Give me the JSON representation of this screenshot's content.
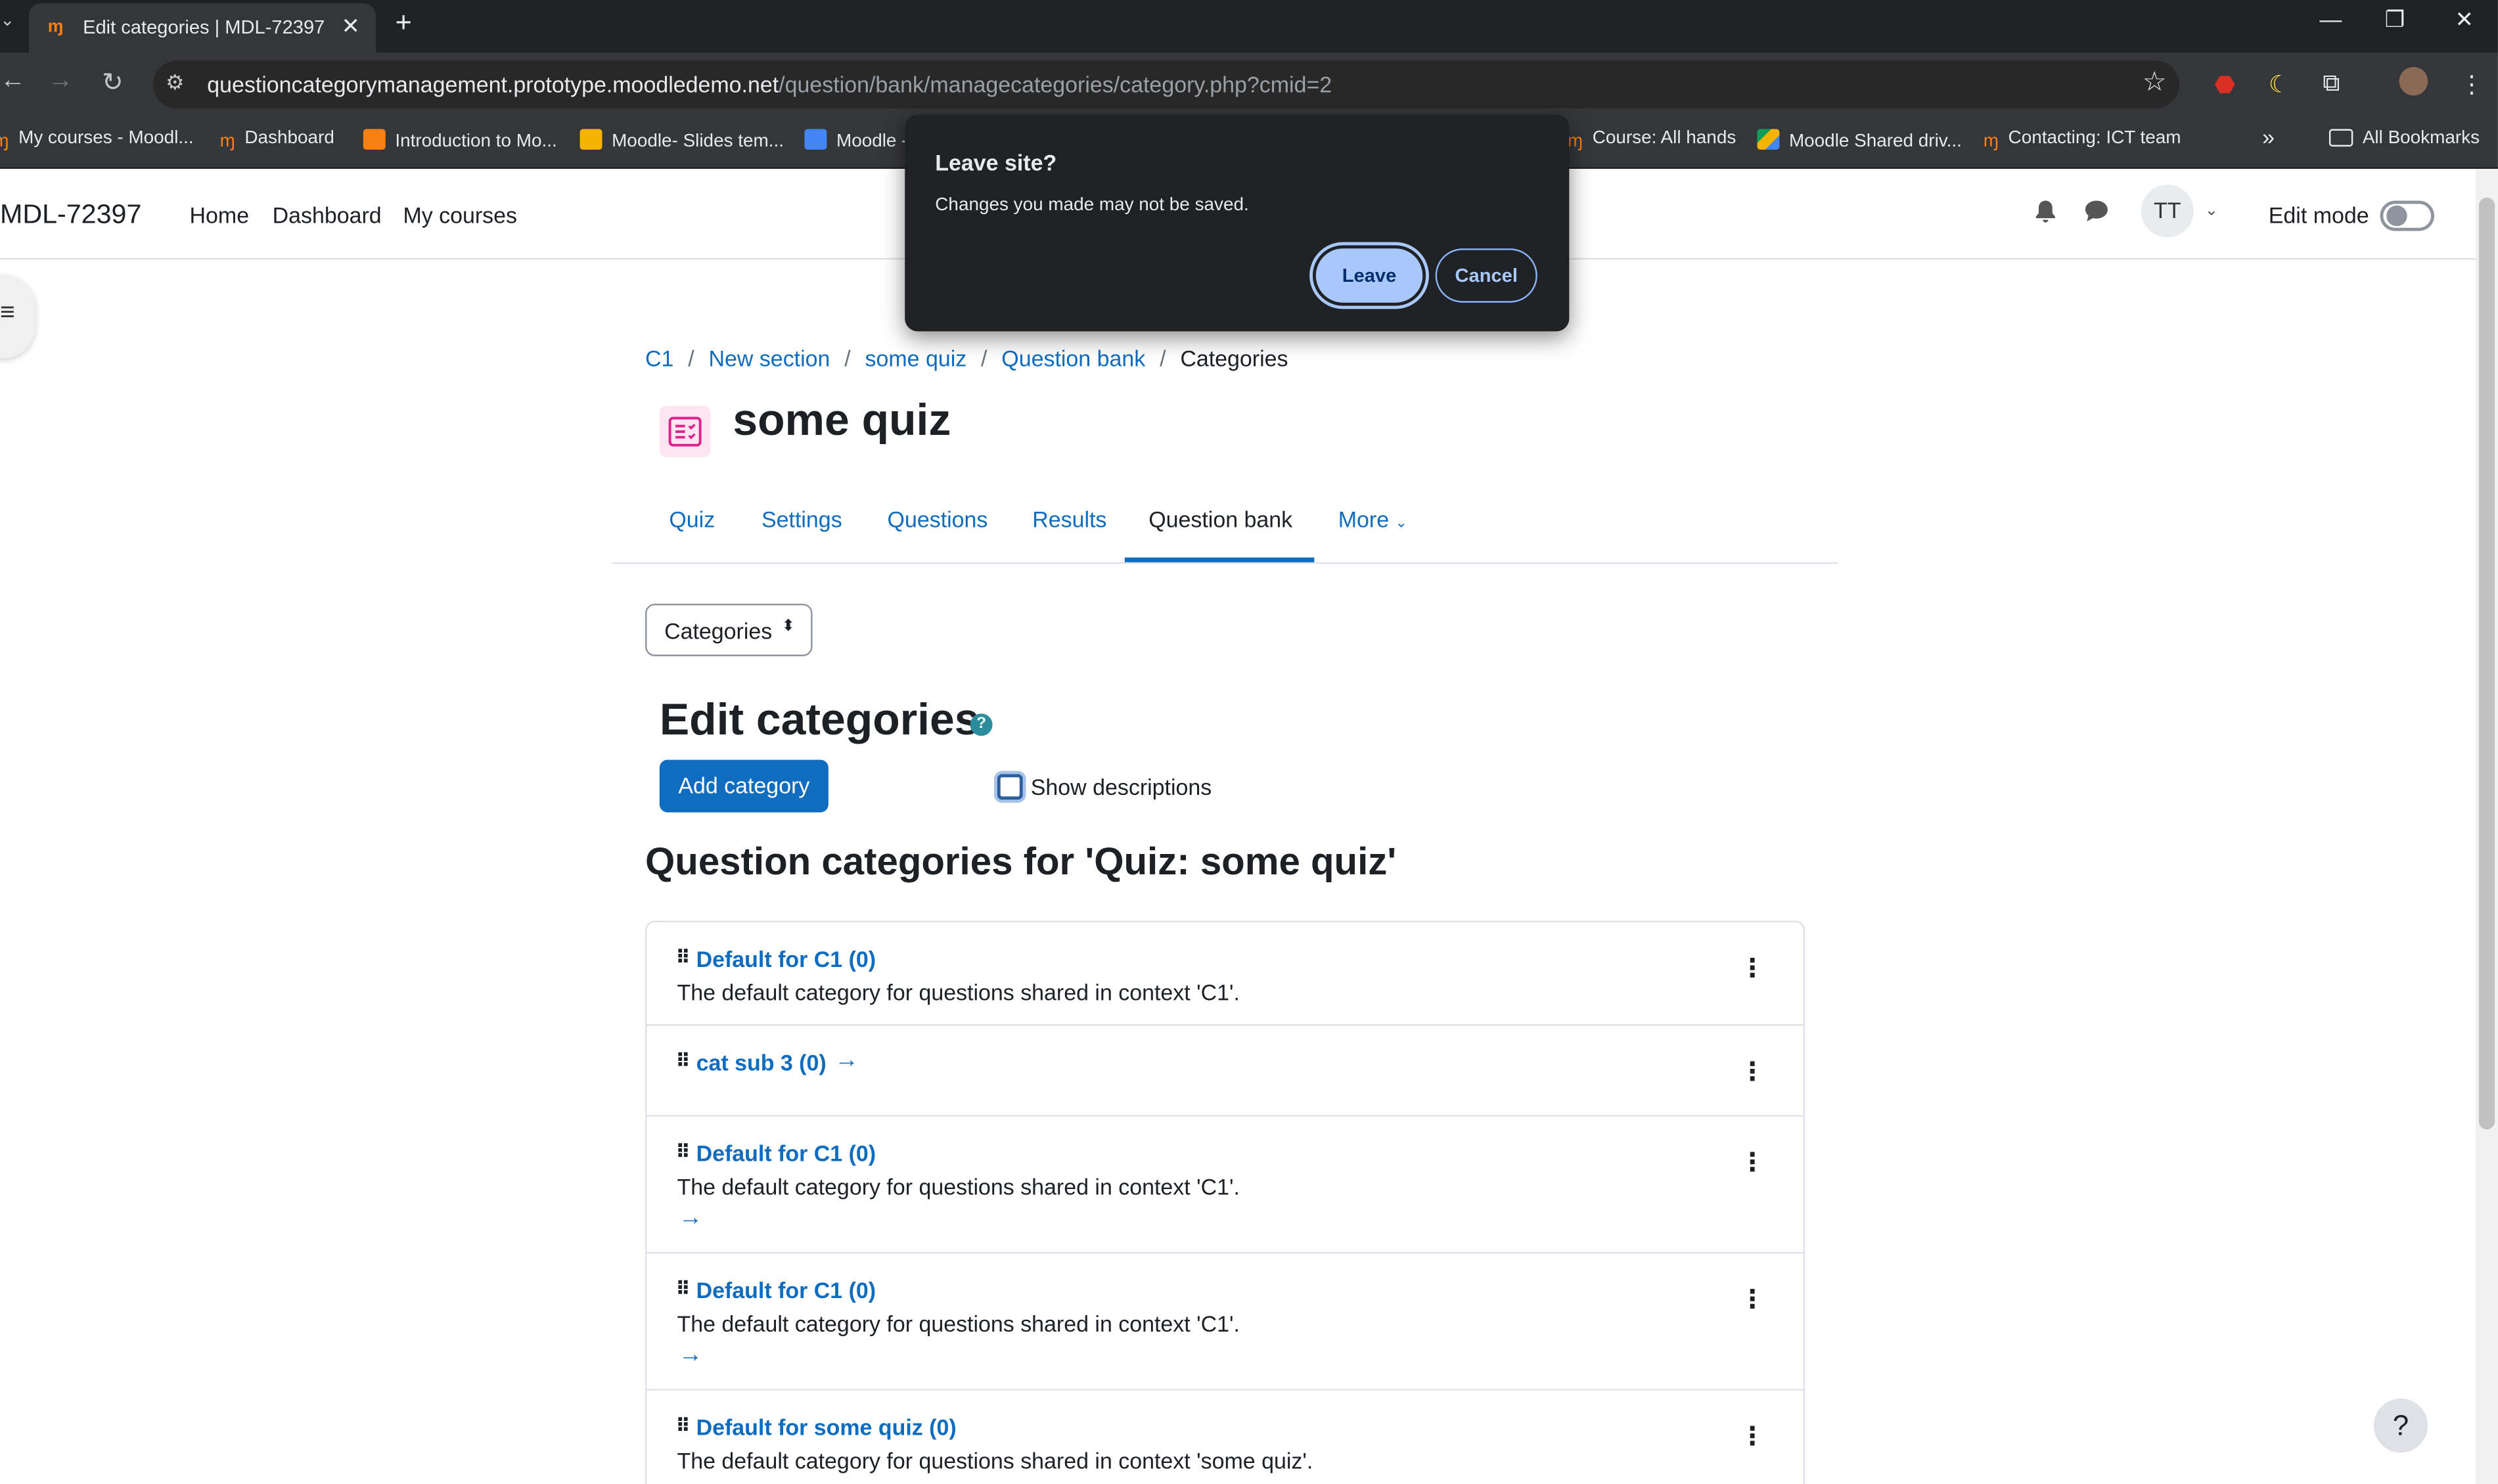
{
  "browser": {
    "tab_title": "Edit categories | MDL-72397",
    "url_host": "questioncategorymanagement.prototype.moodledemo.net",
    "url_path": "/question/bank/managecategories/category.php?cmid=2",
    "bookmarks": [
      "My courses - Moodl...",
      "Dashboard",
      "Introduction to Mo...",
      "Moodle- Slides tem...",
      "Moodle -",
      "Course: All hands",
      "Moodle Shared driv...",
      "Contacting: ICT team"
    ],
    "all_bookmarks": "All Bookmarks",
    "overflow": "»"
  },
  "dialog": {
    "title": "Leave site?",
    "message": "Changes you made may not be saved.",
    "leave_label": "Leave",
    "cancel_label": "Cancel"
  },
  "navbar": {
    "brand": "MDL-72397",
    "items": [
      "Home",
      "Dashboard",
      "My courses"
    ],
    "user_initials": "TT",
    "edit_mode_label": "Edit mode",
    "edit_mode_on": false
  },
  "breadcrumb": [
    "C1",
    "New section",
    "some quiz",
    "Question bank",
    "Categories"
  ],
  "page_title": "some quiz",
  "secondary_nav": {
    "tabs": [
      "Quiz",
      "Settings",
      "Questions",
      "Results",
      "Question bank",
      "More"
    ],
    "active": "Question bank"
  },
  "category_select": "Categories",
  "heading": "Edit categories",
  "help_symbol": "?",
  "add_category_label": "Add category",
  "show_descriptions_label": "Show descriptions",
  "section_heading": "Question categories for 'Quiz: some quiz'",
  "categories": [
    {
      "name": "Default for C1 (0)",
      "description": "The default category for questions shared in context 'C1'."
    },
    {
      "name": "cat sub 3 (0)",
      "description": ""
    },
    {
      "name": "Default for C1 (0)",
      "description": "The default category for questions shared in context 'C1'."
    },
    {
      "name": "Default for C1 (0)",
      "description": "The default category for questions shared in context 'C1'."
    },
    {
      "name": "Default for some quiz (0)",
      "description": "The default category for questions shared in context 'some quiz'."
    }
  ],
  "help_fab": "?",
  "colors": {
    "primary": "#0f6cbf",
    "dialog_bg": "#202124",
    "leave_button": "#a8c7fa",
    "quiz_icon": "#e0218a"
  }
}
